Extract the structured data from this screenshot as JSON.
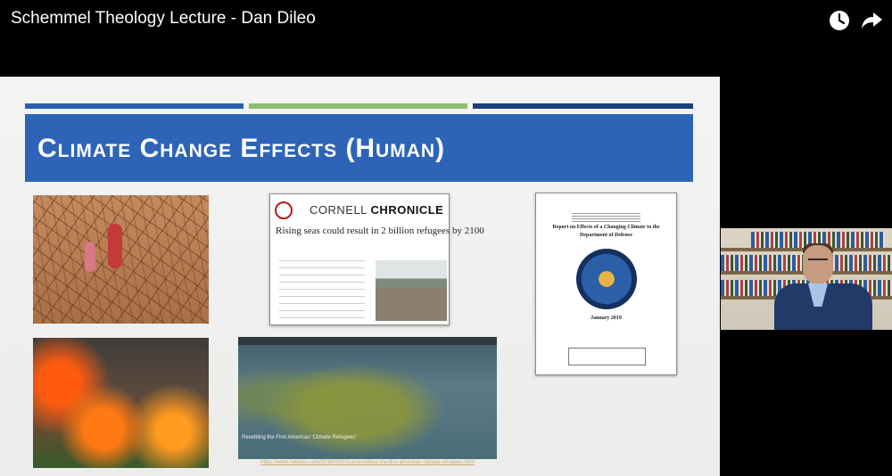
{
  "video": {
    "title": "Schemmel Theology Lecture - Dan Dileo",
    "controls": {
      "watch_later_icon": "clock-icon",
      "share_icon": "share-arrow-icon"
    }
  },
  "slide": {
    "title": "Climate Change Effects (Human)",
    "colors": {
      "banner": "#2d64b8",
      "stripe_left": "#2a5fb0",
      "stripe_middle": "#8cbf6f",
      "stripe_right": "#1d3f77"
    },
    "cornell_card": {
      "publication_prefix": "CORNELL ",
      "publication_suffix": "CHRONICLE",
      "headline": "Rising seas could result in 2 billion refugees by 2100"
    },
    "dod_report": {
      "title": "Report on Effects of a Changing Climate to the Department of Defense",
      "date": "January 2019"
    },
    "wetland_image": {
      "caption": "Resettling the First American 'Climate Refugees'"
    },
    "source_link": "https://www.nytimes.com/2016/05/03/us/resettling-the-first-american-climate-refugees.html"
  }
}
